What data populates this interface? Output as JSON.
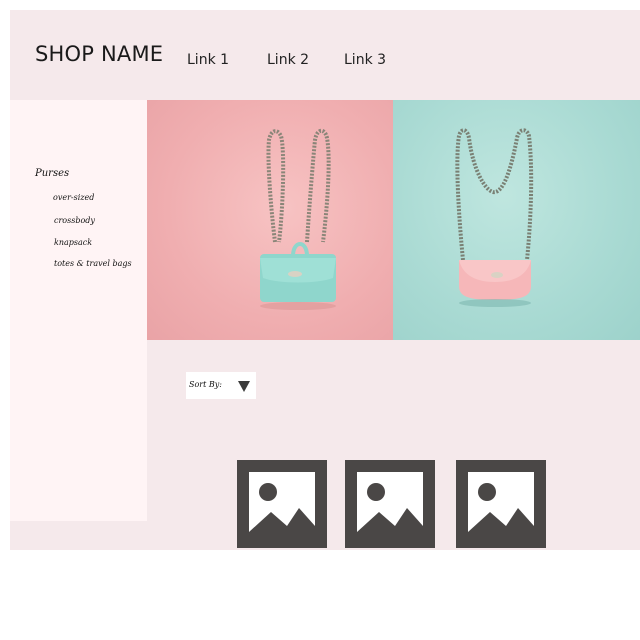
{
  "header": {
    "shop_name": "SHOP NAME",
    "links": [
      "Link 1",
      "Link 2",
      "Link 3"
    ]
  },
  "sidebar": {
    "heading": "Purses",
    "items": [
      "over-sized",
      "crossbody",
      "knapsack",
      "totes & travel bags"
    ]
  },
  "hero": {
    "left_image": {
      "icon": "mint-purse-photo",
      "background": "#f0aeb0",
      "bag_color": "#8fd6cc"
    },
    "right_image": {
      "icon": "pink-purse-photo",
      "background": "#a9dad3",
      "bag_color": "#f6b7b9"
    }
  },
  "sort": {
    "label": "Sort By:",
    "icon": "dropdown-triangle-icon"
  },
  "products": [
    {
      "icon": "image-placeholder-icon"
    },
    {
      "icon": "image-placeholder-icon"
    },
    {
      "icon": "image-placeholder-icon"
    }
  ],
  "colors": {
    "page_background": "#f5e9eb",
    "sidebar_background": "#fff4f5",
    "placeholder": "#4a4746"
  }
}
